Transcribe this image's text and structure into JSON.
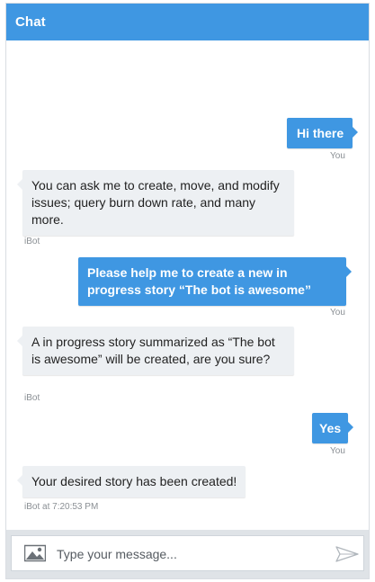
{
  "header": {
    "title": "Chat"
  },
  "messages": [
    {
      "sender": "user",
      "text": "Hi there",
      "label": "You"
    },
    {
      "sender": "bot",
      "text": "You can ask me to create, move, and modify issues; query burn down rate, and many more.",
      "label": "iBot"
    },
    {
      "sender": "user",
      "text": "Please help me to create a new in progress story “The bot is awesome”",
      "label": "You"
    },
    {
      "sender": "bot",
      "text": "A in progress story summarized as “The bot is awesome” will be created, are you sure?",
      "label": "iBot"
    },
    {
      "sender": "user",
      "text": "Yes",
      "label": "You"
    },
    {
      "sender": "bot",
      "text": "Your desired story has been created!",
      "label": "iBot at 7:20:53 PM"
    }
  ],
  "composer": {
    "placeholder": "Type your message...",
    "attach_icon": "image-icon",
    "send_icon": "send-icon"
  },
  "colors": {
    "header": "#3f97e2",
    "user_bubble": "#3f97e2",
    "bot_bubble": "#edf0f3"
  }
}
